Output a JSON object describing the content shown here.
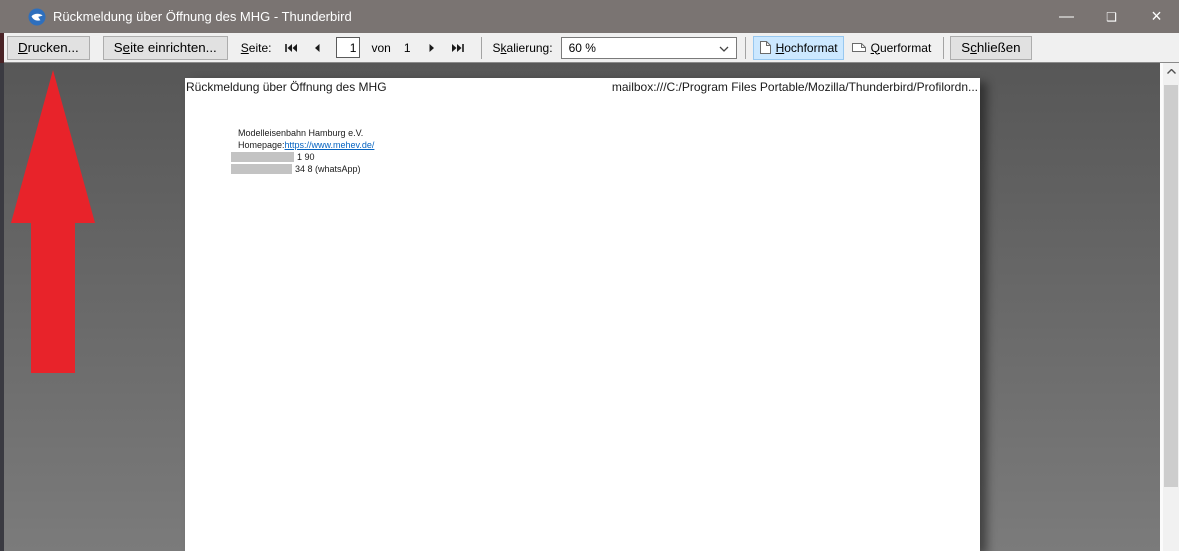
{
  "colors": {
    "titlebar_bg": "#7a7472",
    "toolbar_bg": "#f0f0f0",
    "button_bg": "#e1e1e1",
    "button_border": "#adadad",
    "selected_bg": "#cce8ff",
    "selected_border": "#98c8f0",
    "link": "#0563c1",
    "redaction": "#c3c3c3",
    "red_arrow": "#e8232a",
    "scrollbar_track": "#f1f1f1",
    "scrollbar_thumb": "#cdcdcd"
  },
  "titlebar": {
    "title": "Rückmeldung über Öffnung des MHG - Thunderbird",
    "minimize_glyph": "—",
    "maximize_glyph": "❑",
    "close_glyph": "×"
  },
  "toolbar": {
    "print": {
      "pre": "",
      "key": "D",
      "post": "rucken..."
    },
    "page_setup": {
      "pre": "S",
      "key": "e",
      "post": "ite einrichten..."
    },
    "page": {
      "pre": "",
      "key": "S",
      "post": "eite:"
    },
    "page_value": "1",
    "of_label": "von",
    "total_pages": "1",
    "scale": {
      "pre": "S",
      "key": "k",
      "post": "alierung:"
    },
    "scale_value": "60 %",
    "portrait": {
      "pre": "",
      "key": "H",
      "post": "ochformat"
    },
    "landscape": {
      "pre": "",
      "key": "Q",
      "post": "uerformat"
    },
    "close": {
      "pre": "S",
      "key": "c",
      "post": "hließen"
    }
  },
  "page": {
    "header_left": "Rückmeldung über Öffnung des MHG",
    "header_right": "mailbox:///C:/Program Files Portable/Mozilla/Thunderbird/Profilordn...",
    "line1": "Modelleisenbahn Hamburg e.V.",
    "homepage_label": "Homepage: ",
    "homepage_link": "https://www.mehev.de/",
    "phone_fragment": "1 90",
    "whatsapp_fragment": "34 8 (whatsApp)"
  }
}
